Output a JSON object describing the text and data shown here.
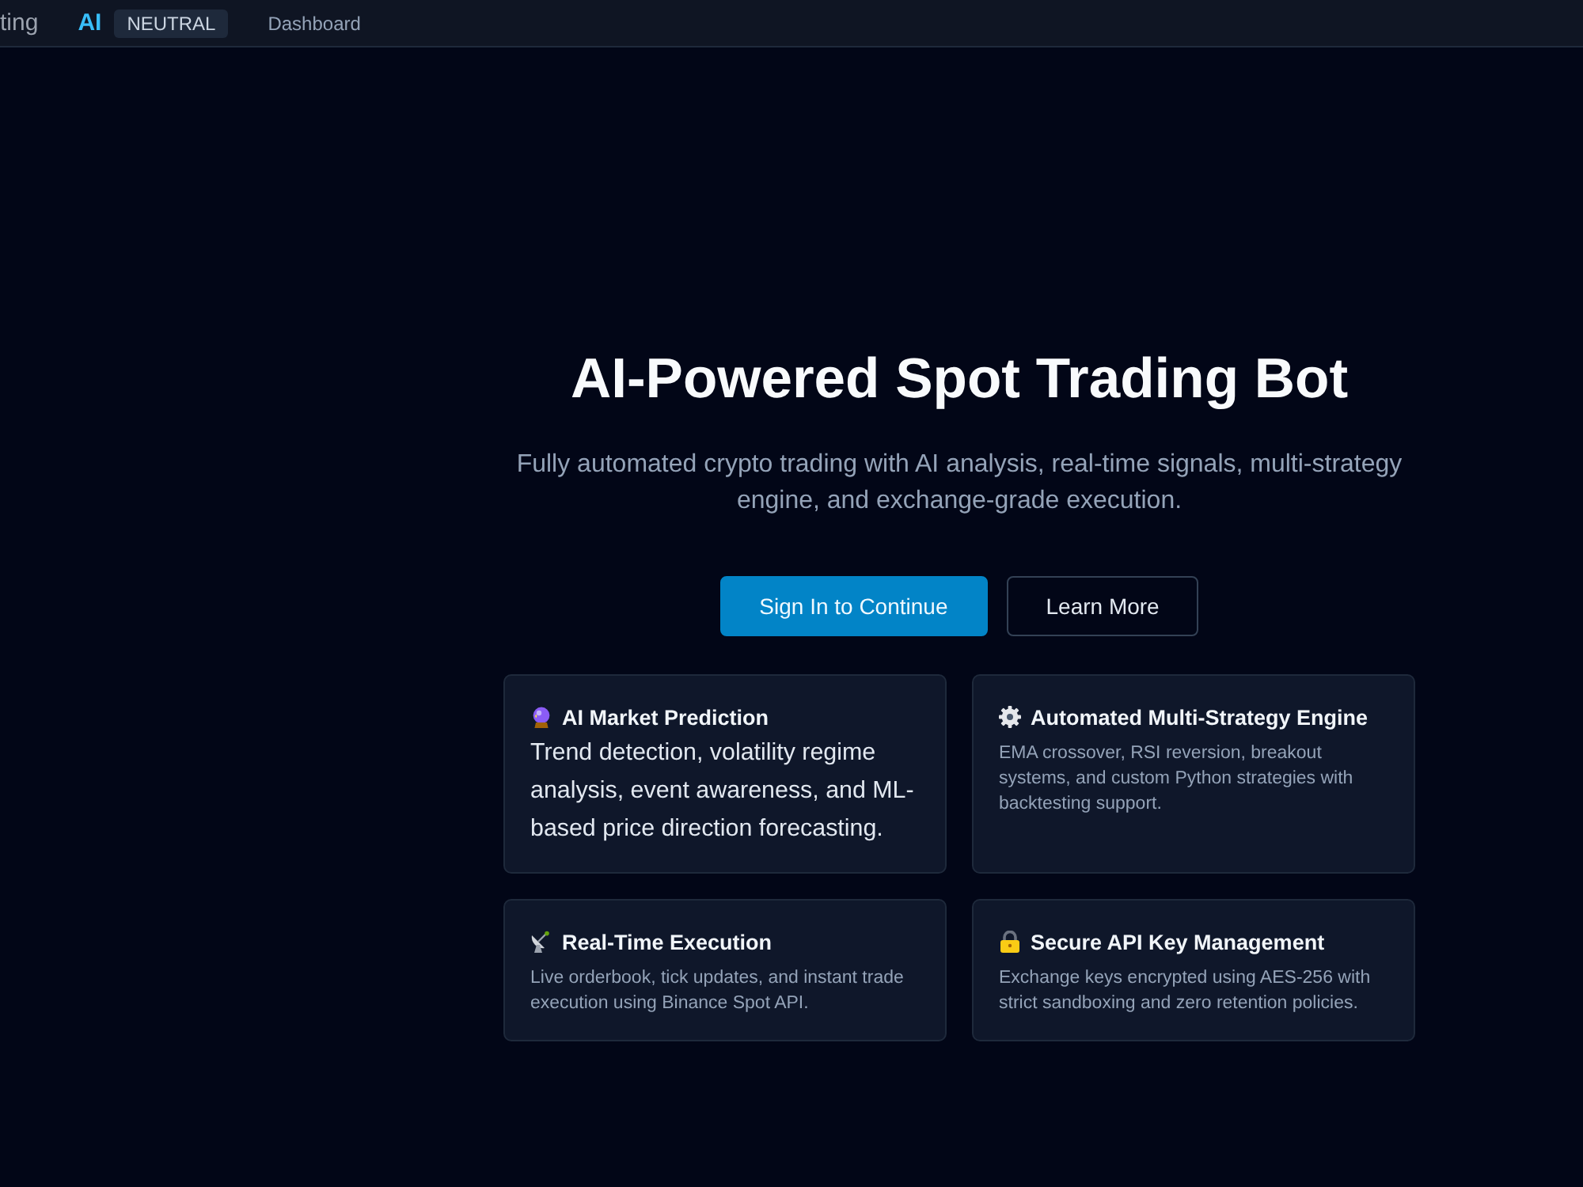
{
  "top_bar": {
    "title_fragment": "ting",
    "ai_signal": {
      "label": "AI",
      "value": "NEUTRAL"
    },
    "links": [
      "Dashboard"
    ]
  },
  "hero": {
    "title": "AI-Powered Spot Trading Bot",
    "subtitle": "Fully automated crypto trading with AI analysis, real-time signals, multi-strategy engine, and exchange-grade execution.",
    "buttons": [
      {
        "label": "Sign In to Continue",
        "kind": "primary"
      },
      {
        "label": "Learn More",
        "kind": "outline"
      }
    ]
  },
  "features": [
    {
      "title": "AI Market Prediction",
      "description": "Trend detection, volatility regime analysis, event awareness, and ML-based price direction forecasting.",
      "kind": "large"
    },
    {
      "title": "Automated Multi-Strategy Engine",
      "description": "EMA crossover, RSI reversion, breakout systems, and custom Python strategies with backtesting support.",
      "kind": "compact"
    },
    {
      "title": "Real-Time Execution",
      "description": "Live orderbook, tick updates, and instant trade execution using Binance Spot API.",
      "kind": "compact"
    },
    {
      "title": "Secure API Key Management",
      "description": "Exchange keys encrypted using AES-256 with strict sandboxing and zero retention policies.",
      "kind": "compact"
    }
  ]
}
